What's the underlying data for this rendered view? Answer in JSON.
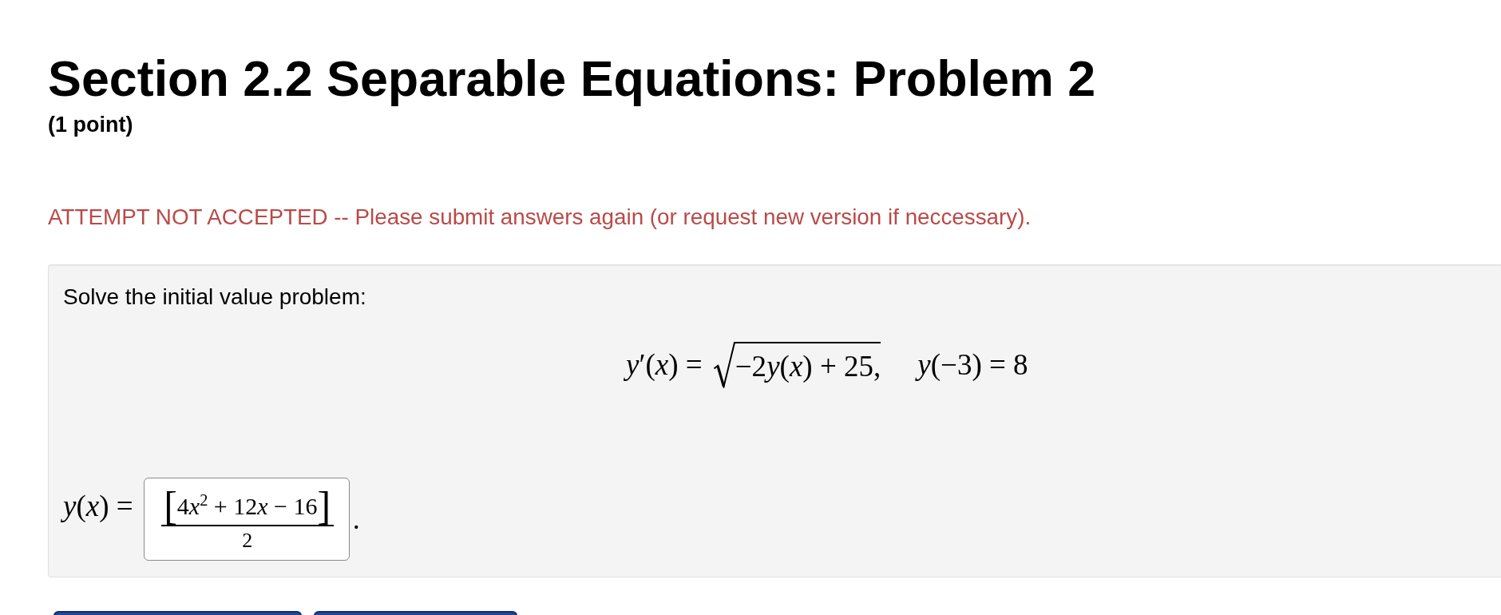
{
  "title": "Section 2.2 Separable Equations: Problem 2",
  "points": "(1 point)",
  "message": {
    "kind": "error",
    "text": "ATTEMPT NOT ACCEPTED -- Please submit answers again (or request new version if neccessary)."
  },
  "problem": {
    "prompt": "Solve the initial value problem:",
    "equation": {
      "lhs": "y′(x) =",
      "radicand": "−2y(x) + 25,",
      "condition": "y(−3) = 8"
    },
    "answer": {
      "label": "y(x) =",
      "open_bracket": "[",
      "numerator": "4x$^{2}$ + 12x − 16",
      "close_bracket": "]",
      "denominator": "2",
      "after": "."
    }
  }
}
